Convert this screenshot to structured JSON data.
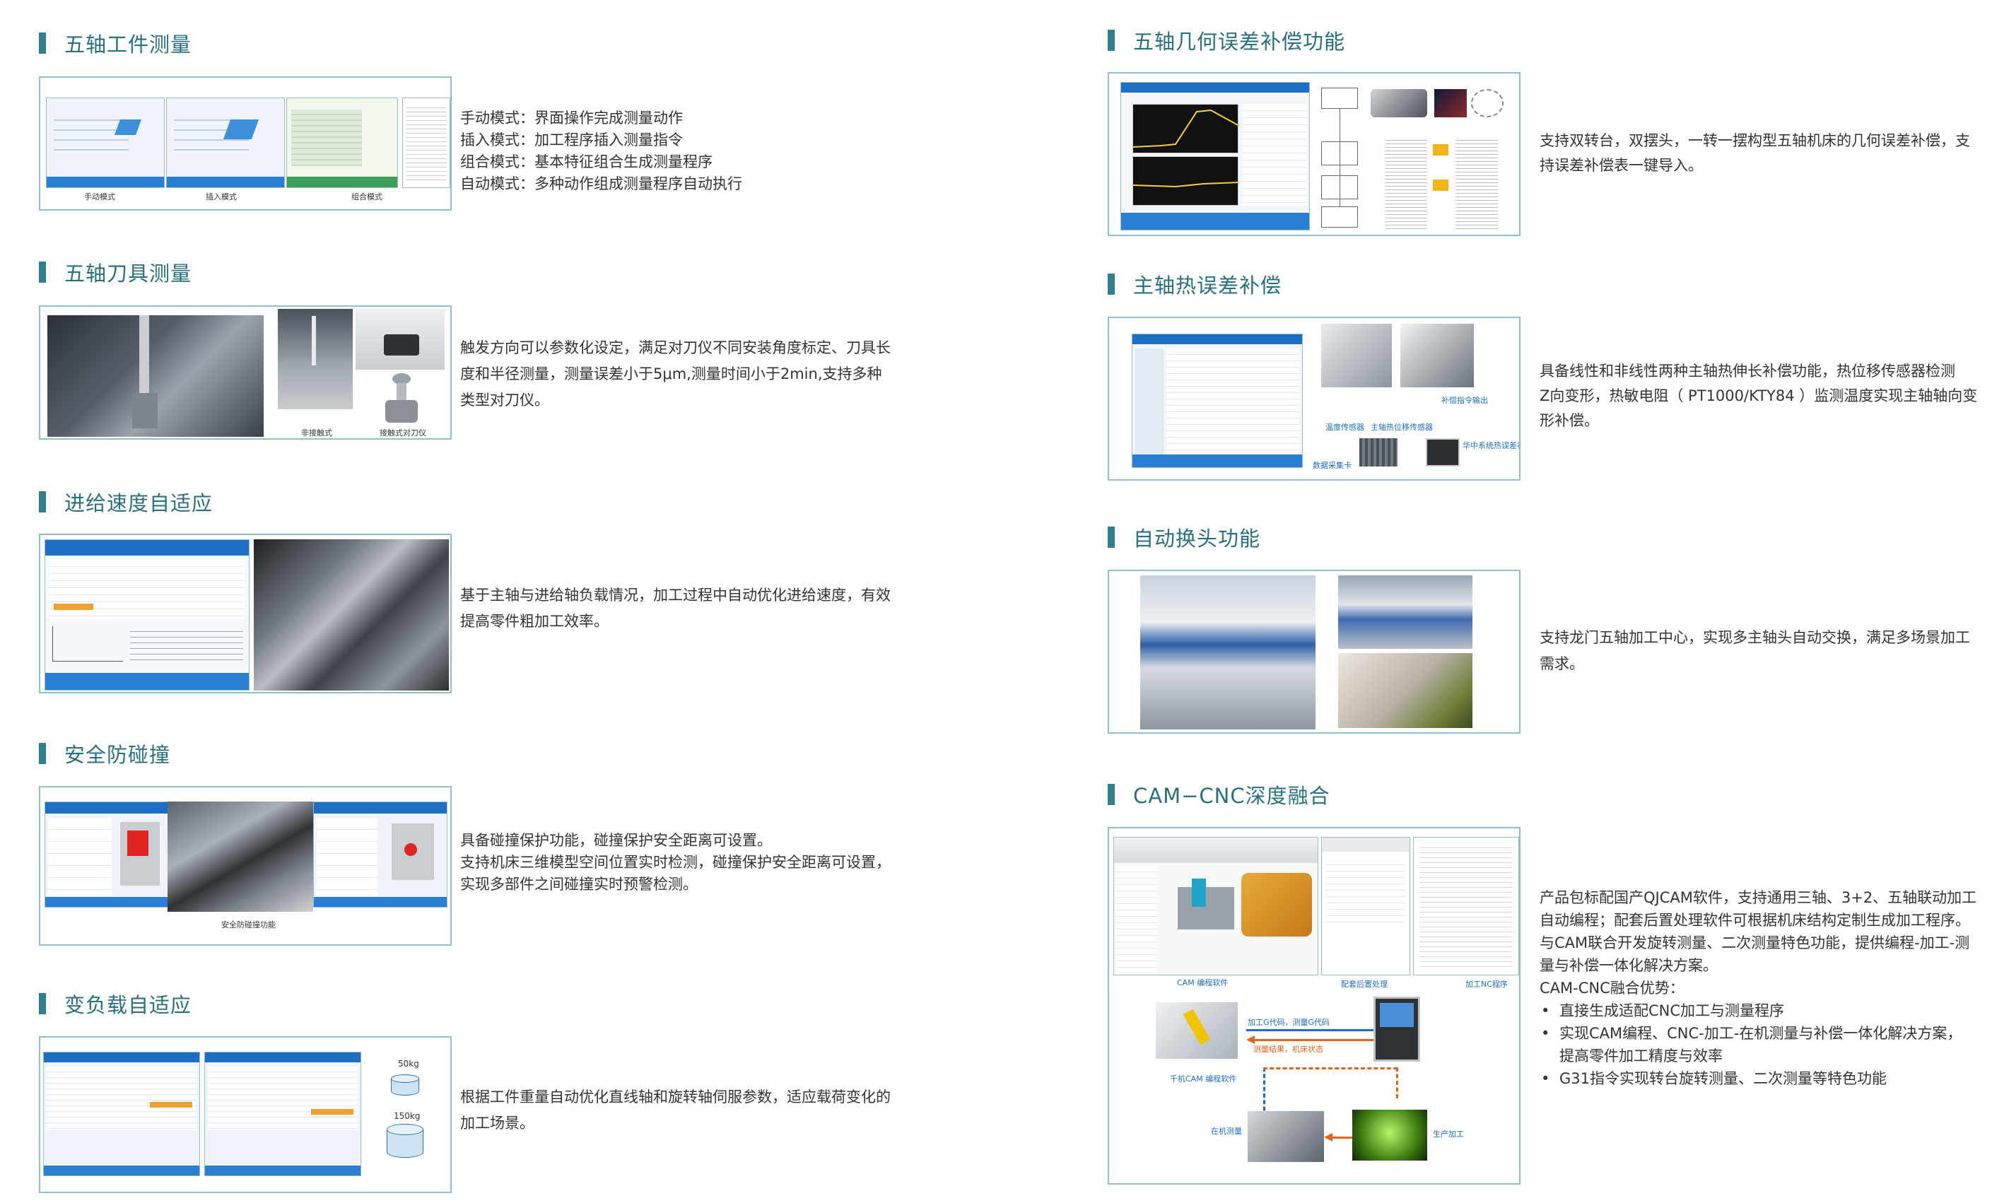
{
  "left_sections": [
    {
      "title": "五轴工件测量",
      "lines": [
        "手动模式：界面操作完成测量动作",
        "插入模式：加工程序插入测量指令",
        "组合模式：基本特征组合生成测量程序",
        "自动模式：多种动作组成测量程序自动执行"
      ],
      "captions": [
        "手动模式",
        "插入模式",
        "组合模式"
      ]
    },
    {
      "title": "五轴刀具测量",
      "lines": [
        "触发方向可以参数化设定，满足对刀仪不同安装角度标定、刀具长",
        "度和半径测量，测量误差小于5μm,测量时间小于2min,支持多种",
        "类型对刀仪。"
      ],
      "captions": [
        "非接触式",
        "接触式对刀仪"
      ]
    },
    {
      "title": "进给速度自适应",
      "lines": [
        "基于主轴与进给轴负载情况，加工过程中自动优化进给速度，有效",
        "提高零件粗加工效率。"
      ],
      "captions": []
    },
    {
      "title": "安全防碰撞",
      "lines": [
        "具备碰撞保护功能，碰撞保护安全距离可设置。",
        "支持机床三维模型空间位置实时检测，碰撞保护安全距离可设置，",
        "实现多部件之间碰撞实时预警检测。"
      ],
      "captions": [
        "安全防碰撞功能"
      ]
    },
    {
      "title": "变负载自适应",
      "lines": [
        "根据工件重量自动优化直线轴和旋转轴伺服参数，适应载荷变化的",
        "加工场景。"
      ],
      "captions": [
        "50kg",
        "150kg"
      ]
    }
  ],
  "right_sections": [
    {
      "title": "五轴几何误差补偿功能",
      "lines": [
        "支持双转台，双摆头，一转一摆构型五轴机床的几何误差补偿，支",
        "持误差补偿表一键导入。"
      ]
    },
    {
      "title": "主轴热误差补偿",
      "lines": [
        "具备线性和非线性两种主轴热伸长补偿功能，热位移传感器检测",
        "Z向变形，热敏电阻（ PT1000/KTY84 ）监测温度实现主轴轴向变",
        "形补偿。"
      ],
      "captions": [
        "温度传感器",
        "主轴热位移传感器",
        "补偿指令输出",
        "数据采集卡",
        "华中系统热误差补偿"
      ]
    },
    {
      "title": "自动换头功能",
      "lines": [
        "支持龙门五轴加工中心，实现多主轴头自动交换，满足多场景加工",
        "需求。"
      ]
    },
    {
      "title": "CAM−CNC深度融合",
      "lines": [
        "产品包标配国产QJCAM软件，支持通用三轴、3+2、五轴联动加工",
        "自动编程；配套后置处理软件可根据机床结构定制生成加工程序。",
        "与CAM联合开发旋转测量、二次测量特色功能，提供编程-加工-测",
        "量与补偿一体化解决方案。",
        "CAM-CNC融合优势："
      ],
      "bullets": [
        "直接生成适配CNC加工与测量程序",
        "实现CAM编程、CNC-加工-在机测量与补偿一体化解决方案，",
        "G31指令实现转台旋转测量、二次测量等特色功能"
      ],
      "bullet_cont": "提高零件加工精度与效率",
      "captions": [
        "CAM 编程软件",
        "配套后置处理",
        "加工NC程序",
        "加工G代码，测量G代码",
        "测量结果，机床状态",
        "千机CAM 编程软件",
        "在机测量",
        "生产加工"
      ]
    }
  ],
  "colors": {
    "accent": "#2f7f8c",
    "title": "#2a6f7c",
    "border": "#8fc0c8",
    "ui_blue": "#1d6fc4"
  }
}
